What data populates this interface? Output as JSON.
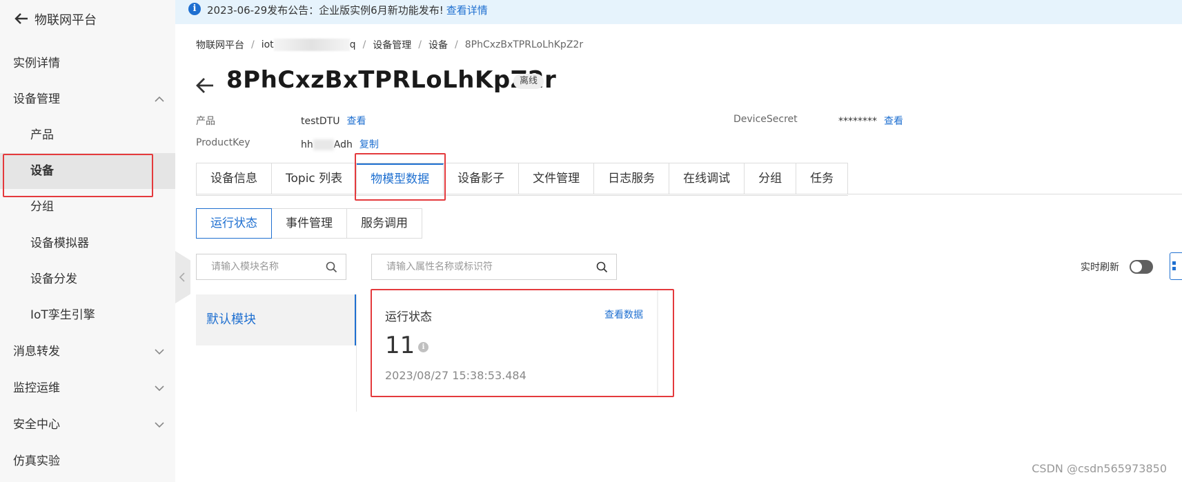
{
  "sidebar": {
    "title": "物联网平台",
    "items": [
      {
        "label": "实例详情",
        "level": 1
      },
      {
        "label": "设备管理",
        "level": 1,
        "expanded": true
      },
      {
        "label": "产品",
        "level": 2
      },
      {
        "label": "设备",
        "level": 2,
        "active": true
      },
      {
        "label": "分组",
        "level": 2
      },
      {
        "label": "设备模拟器",
        "level": 2
      },
      {
        "label": "设备分发",
        "level": 2
      },
      {
        "label": "IoT孪生引擎",
        "level": 2
      },
      {
        "label": "消息转发",
        "level": 1,
        "expanded": false
      },
      {
        "label": "监控运维",
        "level": 1,
        "expanded": false
      },
      {
        "label": "安全中心",
        "level": 1,
        "expanded": false
      },
      {
        "label": "仿真实验",
        "level": 1
      }
    ]
  },
  "notice": {
    "text": "2023-06-29发布公告：企业版实例6月新功能发布!",
    "link": "查看详情",
    "icon": "info-icon"
  },
  "breadcrumb": {
    "items": [
      "物联网平台",
      "iot",
      "q",
      "设备管理",
      "设备",
      "8PhCxzBxTPRLoLhKpZ2r"
    ],
    "separator": "/"
  },
  "device": {
    "name": "8PhCxzBxTPRLoLhKpZ2r",
    "status": "离线",
    "product_label": "产品",
    "product_value": "testDTU",
    "product_link": "查看",
    "productkey_label": "ProductKey",
    "productkey_prefix": "hh",
    "productkey_suffix": "Adh",
    "productkey_link": "复制",
    "secret_label": "DeviceSecret",
    "secret_value": "********",
    "secret_link": "查看"
  },
  "tabs": [
    "设备信息",
    "Topic 列表",
    "物模型数据",
    "设备影子",
    "文件管理",
    "日志服务",
    "在线调试",
    "分组",
    "任务"
  ],
  "active_tab": "物模型数据",
  "subtabs": [
    "运行状态",
    "事件管理",
    "服务调用"
  ],
  "active_subtab": "运行状态",
  "module_search": {
    "placeholder": "请输入模块名称"
  },
  "property_search": {
    "placeholder": "请输入属性名称或标识符"
  },
  "realtime_refresh": {
    "label": "实时刷新",
    "on": false
  },
  "modules": [
    {
      "label": "默认模块",
      "selected": true
    }
  ],
  "property_card": {
    "title": "运行状态",
    "link": "查看数据",
    "value": "11",
    "timestamp": "2023/08/27 15:38:53.484"
  },
  "watermark": "CSDN @csdn565973850",
  "colors": {
    "accent": "#1e6fd0",
    "highlight": "#e4393c",
    "notice_bg": "#e6f3fc",
    "sidebar_bg": "#f7f7f7"
  }
}
